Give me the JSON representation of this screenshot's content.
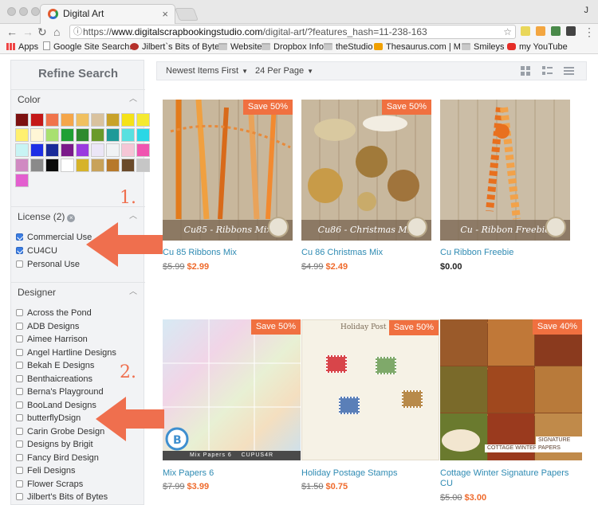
{
  "browser": {
    "tab_title": "Digital Art",
    "profile_initial": "J",
    "url_prefix": "https://",
    "url_domain": "www.digitalscrapbookingstudio.com",
    "url_path": "/digital-art/?features_hash=11-238-163",
    "bookmarks": [
      "Apps",
      "Google Site Search...",
      "Jilbert`s Bits of Bytes",
      "Website",
      "Dropbox Info",
      "theStudio",
      "Thesaurus.com | M...",
      "Smileys",
      "my YouTube"
    ]
  },
  "sidebar": {
    "title": "Refine Search",
    "color_heading": "Color",
    "colors": [
      "#7c1010",
      "#c41818",
      "#f0744c",
      "#f5a64a",
      "#f0c060",
      "#d9c29e",
      "#c8a22a",
      "#f5e218",
      "#f5ea30",
      "#fff070",
      "#fff6d6",
      "#a8e070",
      "#1fa034",
      "#2e8a2e",
      "#6a9a2a",
      "#1e9a98",
      "#58e0e0",
      "#2ad7e6",
      "#c8f4f4",
      "#1d2fe6",
      "#1a2b99",
      "#7a1a8a",
      "#9a3adf",
      "#ebe6f7",
      "#f0f2f4",
      "#f5c6d6",
      "#f055b0",
      "#d08ac2",
      "#8a8a8a",
      "#0a0a0a",
      "#ffffff",
      "#d6b32a",
      "#c8a25a",
      "#b7792a",
      "#6a4a2a",
      "#c6c6c6",
      "#e35fcf"
    ],
    "license_heading": "License (2)",
    "license_items": [
      {
        "label": "Commercial Use",
        "checked": true
      },
      {
        "label": "CU4CU",
        "checked": true
      },
      {
        "label": "Personal Use",
        "checked": false
      }
    ],
    "designer_heading": "Designer",
    "designers": [
      "Across the Pond",
      "ADB Designs",
      "Aimee Harrison",
      "Angel Hartline Designs",
      "Bekah E Designs",
      "Benthaicreations",
      "Berna's Playground",
      "BooLand Designs",
      "butterflyDsign",
      "Carin Grobe Design",
      "Designs by Brigit",
      "Fancy Bird Design",
      "Feli Designs",
      "Flower Scraps",
      "Jilbert's Bits of Bytes"
    ]
  },
  "sortbar": {
    "sort": "Newest Items First",
    "per_page": "24 Per Page"
  },
  "products": [
    {
      "title": "Cu 85 Ribbons Mix",
      "old_price": "$5.99",
      "new_price": "$2.99",
      "save": "Save 50%",
      "banner": "Cu85 - Ribbons Mix",
      "bg": "#b9a78d"
    },
    {
      "title": "Cu 86 Christmas Mix",
      "old_price": "$4.99",
      "new_price": "$2.49",
      "save": "Save 50%",
      "banner": "Cu86 - Christmas Mix",
      "bg": "#b8a58a"
    },
    {
      "title": "Cu Ribbon Freebie",
      "price": "$0.00",
      "banner": "Cu - Ribbon Freebie",
      "bg": "#bcab92"
    },
    {
      "title": "Mix Papers 6",
      "old_price": "$7.99",
      "new_price": "$3.99",
      "save": "Save 50%",
      "caption": "Mix Papers 6",
      "code": "CUPUS4R"
    },
    {
      "title": "Holiday Postage Stamps",
      "old_price": "$1.50",
      "new_price": "$0.75",
      "save": "Save 50%",
      "header": "Holiday Post"
    },
    {
      "title": "Cottage Winter Signature Papers CU",
      "old_price": "$5.00",
      "new_price": "$3.00",
      "save": "Save 40%",
      "caption": "COTTAGE WINTER",
      "caption2": "SIGNATURE PAPERS"
    }
  ],
  "annotations": [
    "1.",
    "2."
  ],
  "accent_color": "#ef6f4e"
}
